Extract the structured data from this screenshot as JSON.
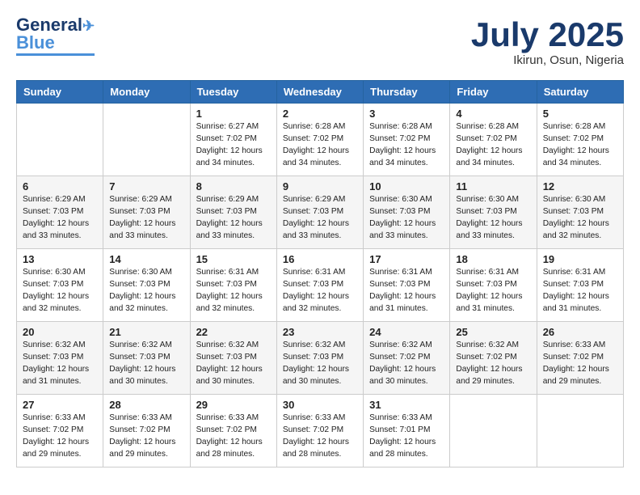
{
  "header": {
    "logo_general": "General",
    "logo_blue": "Blue",
    "month": "July 2025",
    "location": "Ikirun, Osun, Nigeria"
  },
  "weekdays": [
    "Sunday",
    "Monday",
    "Tuesday",
    "Wednesday",
    "Thursday",
    "Friday",
    "Saturday"
  ],
  "weeks": [
    [
      {
        "day": "",
        "info": ""
      },
      {
        "day": "",
        "info": ""
      },
      {
        "day": "1",
        "info": "Sunrise: 6:27 AM\nSunset: 7:02 PM\nDaylight: 12 hours and 34 minutes."
      },
      {
        "day": "2",
        "info": "Sunrise: 6:28 AM\nSunset: 7:02 PM\nDaylight: 12 hours and 34 minutes."
      },
      {
        "day": "3",
        "info": "Sunrise: 6:28 AM\nSunset: 7:02 PM\nDaylight: 12 hours and 34 minutes."
      },
      {
        "day": "4",
        "info": "Sunrise: 6:28 AM\nSunset: 7:02 PM\nDaylight: 12 hours and 34 minutes."
      },
      {
        "day": "5",
        "info": "Sunrise: 6:28 AM\nSunset: 7:02 PM\nDaylight: 12 hours and 34 minutes."
      }
    ],
    [
      {
        "day": "6",
        "info": "Sunrise: 6:29 AM\nSunset: 7:03 PM\nDaylight: 12 hours and 33 minutes."
      },
      {
        "day": "7",
        "info": "Sunrise: 6:29 AM\nSunset: 7:03 PM\nDaylight: 12 hours and 33 minutes."
      },
      {
        "day": "8",
        "info": "Sunrise: 6:29 AM\nSunset: 7:03 PM\nDaylight: 12 hours and 33 minutes."
      },
      {
        "day": "9",
        "info": "Sunrise: 6:29 AM\nSunset: 7:03 PM\nDaylight: 12 hours and 33 minutes."
      },
      {
        "day": "10",
        "info": "Sunrise: 6:30 AM\nSunset: 7:03 PM\nDaylight: 12 hours and 33 minutes."
      },
      {
        "day": "11",
        "info": "Sunrise: 6:30 AM\nSunset: 7:03 PM\nDaylight: 12 hours and 33 minutes."
      },
      {
        "day": "12",
        "info": "Sunrise: 6:30 AM\nSunset: 7:03 PM\nDaylight: 12 hours and 32 minutes."
      }
    ],
    [
      {
        "day": "13",
        "info": "Sunrise: 6:30 AM\nSunset: 7:03 PM\nDaylight: 12 hours and 32 minutes."
      },
      {
        "day": "14",
        "info": "Sunrise: 6:30 AM\nSunset: 7:03 PM\nDaylight: 12 hours and 32 minutes."
      },
      {
        "day": "15",
        "info": "Sunrise: 6:31 AM\nSunset: 7:03 PM\nDaylight: 12 hours and 32 minutes."
      },
      {
        "day": "16",
        "info": "Sunrise: 6:31 AM\nSunset: 7:03 PM\nDaylight: 12 hours and 32 minutes."
      },
      {
        "day": "17",
        "info": "Sunrise: 6:31 AM\nSunset: 7:03 PM\nDaylight: 12 hours and 31 minutes."
      },
      {
        "day": "18",
        "info": "Sunrise: 6:31 AM\nSunset: 7:03 PM\nDaylight: 12 hours and 31 minutes."
      },
      {
        "day": "19",
        "info": "Sunrise: 6:31 AM\nSunset: 7:03 PM\nDaylight: 12 hours and 31 minutes."
      }
    ],
    [
      {
        "day": "20",
        "info": "Sunrise: 6:32 AM\nSunset: 7:03 PM\nDaylight: 12 hours and 31 minutes."
      },
      {
        "day": "21",
        "info": "Sunrise: 6:32 AM\nSunset: 7:03 PM\nDaylight: 12 hours and 30 minutes."
      },
      {
        "day": "22",
        "info": "Sunrise: 6:32 AM\nSunset: 7:03 PM\nDaylight: 12 hours and 30 minutes."
      },
      {
        "day": "23",
        "info": "Sunrise: 6:32 AM\nSunset: 7:03 PM\nDaylight: 12 hours and 30 minutes."
      },
      {
        "day": "24",
        "info": "Sunrise: 6:32 AM\nSunset: 7:02 PM\nDaylight: 12 hours and 30 minutes."
      },
      {
        "day": "25",
        "info": "Sunrise: 6:32 AM\nSunset: 7:02 PM\nDaylight: 12 hours and 29 minutes."
      },
      {
        "day": "26",
        "info": "Sunrise: 6:33 AM\nSunset: 7:02 PM\nDaylight: 12 hours and 29 minutes."
      }
    ],
    [
      {
        "day": "27",
        "info": "Sunrise: 6:33 AM\nSunset: 7:02 PM\nDaylight: 12 hours and 29 minutes."
      },
      {
        "day": "28",
        "info": "Sunrise: 6:33 AM\nSunset: 7:02 PM\nDaylight: 12 hours and 29 minutes."
      },
      {
        "day": "29",
        "info": "Sunrise: 6:33 AM\nSunset: 7:02 PM\nDaylight: 12 hours and 28 minutes."
      },
      {
        "day": "30",
        "info": "Sunrise: 6:33 AM\nSunset: 7:02 PM\nDaylight: 12 hours and 28 minutes."
      },
      {
        "day": "31",
        "info": "Sunrise: 6:33 AM\nSunset: 7:01 PM\nDaylight: 12 hours and 28 minutes."
      },
      {
        "day": "",
        "info": ""
      },
      {
        "day": "",
        "info": ""
      }
    ]
  ]
}
